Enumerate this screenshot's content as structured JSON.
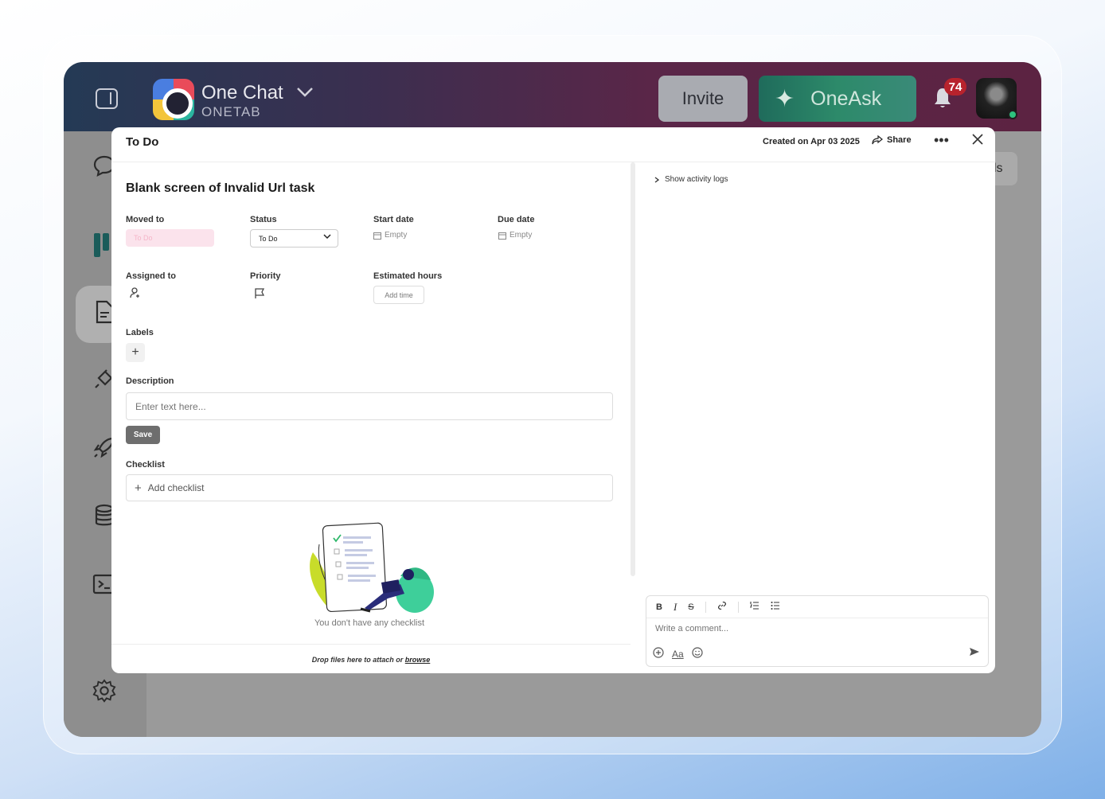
{
  "app": {
    "title": "One Chat",
    "subtitle": "ONETAB",
    "invite_label": "Invite",
    "oneask_label": "OneAsk",
    "notification_count": "74",
    "right_stub_text": "ls"
  },
  "modal": {
    "title": "To Do",
    "created_on": "Created on Apr 03 2025",
    "share_label": "Share",
    "task_title": "Blank screen of Invalid Url task",
    "fields": {
      "moved_to_label": "Moved to",
      "moved_to_value": "To Do",
      "status_label": "Status",
      "status_value": "To Do",
      "start_date_label": "Start date",
      "start_date_value": "Empty",
      "due_date_label": "Due date",
      "due_date_value": "Empty",
      "assigned_to_label": "Assigned to",
      "priority_label": "Priority",
      "estimated_hours_label": "Estimated hours",
      "add_time_label": "Add time",
      "labels_label": "Labels",
      "description_label": "Description",
      "description_placeholder": "Enter text here...",
      "save_label": "Save",
      "checklist_label": "Checklist",
      "add_checklist_label": "Add checklist",
      "empty_checklist_text": "You don't have any checklist"
    },
    "drop_zone_text": "Drop files here to attach or",
    "drop_zone_link": "browse",
    "activity_logs_label": "Show activity logs",
    "comment_placeholder": "Write a comment...",
    "font_size_label": "Aa"
  },
  "colors": {
    "oneask_bg": "#2d8a6a",
    "badge_bg": "#b8232d",
    "presence": "#2ec27e"
  }
}
